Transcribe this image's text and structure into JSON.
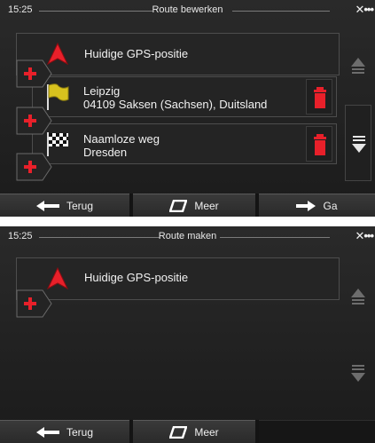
{
  "screen1": {
    "status": {
      "time": "15:25",
      "title": "Route bewerken"
    },
    "waypoints": [
      {
        "name": "Huidige GPS-positie",
        "detail": "",
        "icon": "red-arrow-icon"
      },
      {
        "name": "Leipzig",
        "detail": "04109 Saksen (Sachsen), Duitsland",
        "icon": "yellow-flag-icon"
      },
      {
        "name": "Naamloze weg",
        "detail": "Dresden",
        "icon": "checkered-flag-icon"
      }
    ],
    "buttons": {
      "back": "Terug",
      "more": "Meer",
      "go": "Ga"
    }
  },
  "screen2": {
    "status": {
      "time": "15:25",
      "title": "Route maken"
    },
    "waypoints": [
      {
        "name": "Huidige GPS-positie",
        "icon": "red-arrow-icon"
      }
    ],
    "buttons": {
      "back": "Terug",
      "more": "Meer"
    }
  },
  "colors": {
    "accent_red": "#e8202a",
    "background": "#232323",
    "text": "#f2f2f2"
  }
}
